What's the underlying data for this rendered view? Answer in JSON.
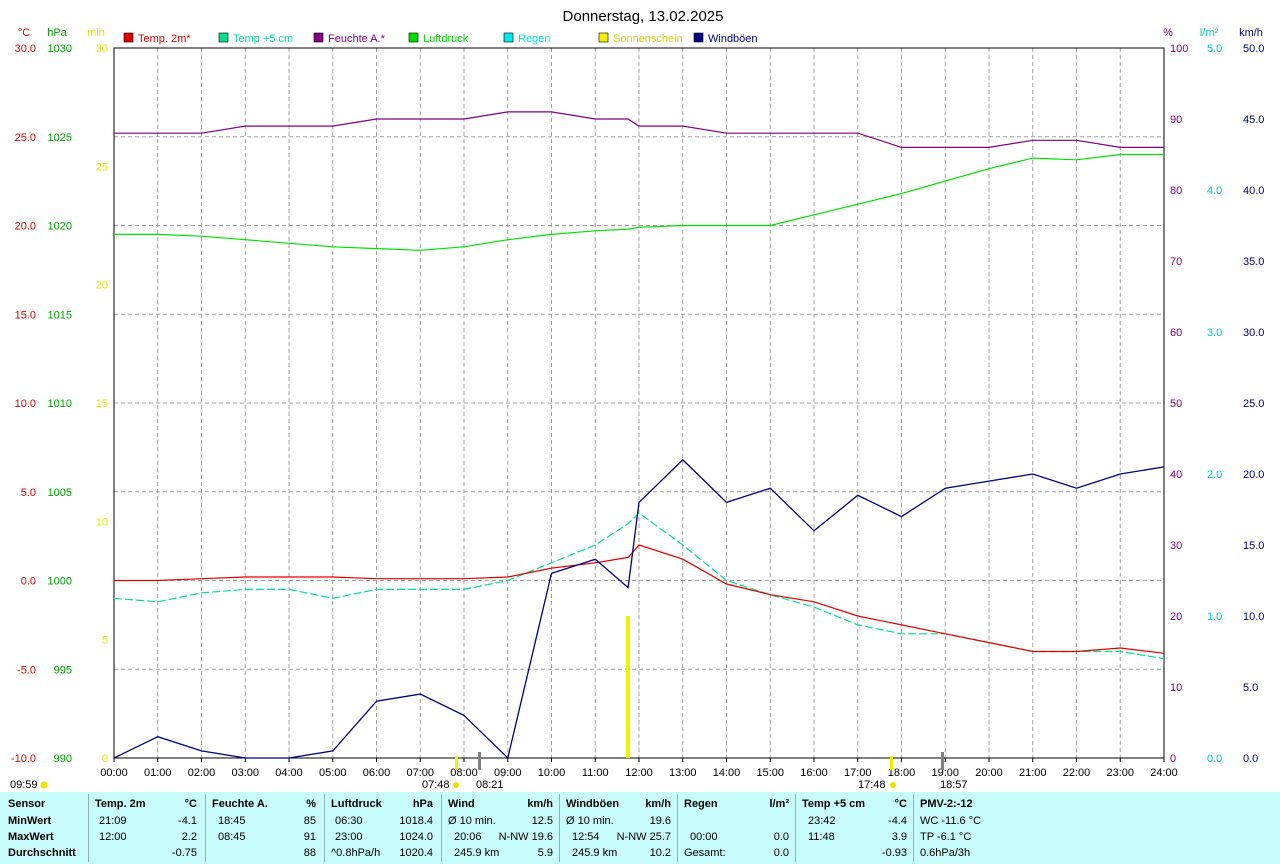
{
  "title": "Donnerstag, 13.02.2025",
  "legend": [
    {
      "label": "Temp. 2m*",
      "color": "#e00000"
    },
    {
      "label": "Temp +5 cm",
      "color": "#00e090"
    },
    {
      "label": "Feuchte A.*",
      "color": "#800080"
    },
    {
      "label": "Luftdruck",
      "color": "#00e000"
    },
    {
      "label": "Regen",
      "color": "#00e8e8"
    },
    {
      "label": "Sonnenschein",
      "color": "#f0f000"
    },
    {
      "label": "Windböen",
      "color": "#000080"
    }
  ],
  "axes": {
    "temp": {
      "unit": "°C",
      "ticks": [
        "30.0",
        "25.0",
        "20.0",
        "15.0",
        "10.0",
        "5.0",
        "0.0",
        "-5.0",
        "-10.0"
      ],
      "color": "#e00000"
    },
    "pressure": {
      "unit": "hPa",
      "ticks": [
        "1030",
        "1025",
        "1020",
        "1015",
        "1010",
        "1005",
        "1000",
        "995",
        "990"
      ],
      "color": "#00a000"
    },
    "sun": {
      "unit": "min",
      "ticks": [
        "30",
        "25",
        "20",
        "15",
        "10",
        "5",
        "0"
      ],
      "color": "#e8e800"
    },
    "humidity": {
      "unit": "%",
      "ticks": [
        "100",
        "90",
        "80",
        "70",
        "60",
        "50",
        "40",
        "30",
        "20",
        "10",
        "0"
      ],
      "color": "#800080"
    },
    "rain": {
      "unit": "l/m²",
      "ticks": [
        "5.0",
        "4.0",
        "3.0",
        "2.0",
        "1.0",
        "0.0"
      ],
      "color": "#00c8c8"
    },
    "wind": {
      "unit": "km/h",
      "ticks": [
        "50.0",
        "45.0",
        "40.0",
        "35.0",
        "30.0",
        "25.0",
        "20.0",
        "15.0",
        "10.0",
        "5.0",
        "0.0"
      ],
      "color": "#000080"
    },
    "time": [
      "00:00",
      "01:00",
      "02:00",
      "03:00",
      "04:00",
      "05:00",
      "06:00",
      "07:00",
      "08:00",
      "09:00",
      "10:00",
      "11:00",
      "12:00",
      "13:00",
      "14:00",
      "15:00",
      "16:00",
      "17:00",
      "18:00",
      "19:00",
      "20:00",
      "21:00",
      "22:00",
      "23:00",
      "24:00"
    ]
  },
  "markers": {
    "update": "09:59",
    "sunrise": "07:48",
    "moonset": "08:21",
    "sunset": "17:48",
    "moonrise": "18:57"
  },
  "chart_data": {
    "type": "line",
    "x": [
      "00:00",
      "01:00",
      "02:00",
      "03:00",
      "04:00",
      "05:00",
      "06:00",
      "07:00",
      "08:00",
      "09:00",
      "10:00",
      "11:00",
      "11:45",
      "12:00",
      "13:00",
      "14:00",
      "15:00",
      "16:00",
      "17:00",
      "18:00",
      "19:00",
      "20:00",
      "21:00",
      "22:00",
      "23:00",
      "24:00"
    ],
    "series": [
      {
        "name": "Temp. 2m*",
        "axis": "temp",
        "unit": "°C",
        "values": [
          0.0,
          0.0,
          0.1,
          0.2,
          0.2,
          0.2,
          0.1,
          0.1,
          0.1,
          0.2,
          0.7,
          1.0,
          1.3,
          2.0,
          1.2,
          -0.2,
          -0.8,
          -1.2,
          -2.0,
          -2.5,
          -3.0,
          -3.5,
          -4.0,
          -4.0,
          -3.8,
          -4.1
        ]
      },
      {
        "name": "Temp +5 cm",
        "axis": "temp",
        "unit": "°C",
        "values": [
          -1.0,
          -1.2,
          -0.7,
          -0.5,
          -0.5,
          -1.0,
          -0.5,
          -0.5,
          -0.5,
          0.0,
          1.0,
          2.0,
          3.2,
          3.8,
          2.0,
          0.0,
          -0.8,
          -1.5,
          -2.5,
          -3.0,
          -3.0,
          -3.5,
          -4.0,
          -4.0,
          -4.0,
          -4.4
        ]
      },
      {
        "name": "Feuchte A.*",
        "axis": "humidity",
        "unit": "%",
        "values": [
          88,
          88,
          88,
          89,
          89,
          89,
          90,
          90,
          90,
          91,
          91,
          90,
          90,
          89,
          89,
          88,
          88,
          88,
          88,
          86,
          86,
          86,
          87,
          87,
          86,
          86
        ]
      },
      {
        "name": "Luftdruck",
        "axis": "pressure",
        "unit": "hPa",
        "values": [
          1019.5,
          1019.5,
          1019.4,
          1019.2,
          1019.0,
          1018.8,
          1018.7,
          1018.6,
          1018.8,
          1019.2,
          1019.5,
          1019.7,
          1019.8,
          1019.9,
          1020.0,
          1020.0,
          1020.0,
          1020.6,
          1021.2,
          1021.8,
          1022.5,
          1023.2,
          1023.8,
          1023.7,
          1024.0,
          1024.0
        ]
      },
      {
        "name": "Windböen",
        "axis": "wind",
        "unit": "km/h",
        "values": [
          0.0,
          1.5,
          0.5,
          0.0,
          0.0,
          0.5,
          4.0,
          4.5,
          3.0,
          0.0,
          13.0,
          14.0,
          12.0,
          18.0,
          21.0,
          18.0,
          19.0,
          16.0,
          18.5,
          17.0,
          19.0,
          19.5,
          20.0,
          19.0,
          20.0,
          20.5
        ]
      }
    ],
    "sunshine": {
      "name": "Sonnenschein",
      "axis": "sun",
      "unit": "min",
      "bars": [
        {
          "x": "11:45",
          "value": 6
        }
      ]
    },
    "xlabel": "",
    "ylim_temp": [
      -10,
      30
    ],
    "ylim_pressure": [
      990,
      1030
    ],
    "ylim_humidity": [
      0,
      100
    ],
    "ylim_rain": [
      0,
      5
    ],
    "ylim_wind": [
      0,
      50
    ],
    "ylim_sun": [
      0,
      30
    ],
    "grid": true
  },
  "stats": {
    "headers": [
      {
        "name": "Sensor",
        "unit": ""
      },
      {
        "name": "Temp. 2m",
        "unit": "°C"
      },
      {
        "name": "Feuchte A.",
        "unit": "%"
      },
      {
        "name": "Luftdruck",
        "unit": "hPa"
      },
      {
        "name": "Wind",
        "unit": "km/h"
      },
      {
        "name": "Windböen",
        "unit": "km/h"
      },
      {
        "name": "Regen",
        "unit": "l/m²"
      },
      {
        "name": "Temp +5 cm",
        "unit": "°C"
      },
      {
        "name": "PMV-2:-12",
        "unit": ""
      }
    ],
    "rows": [
      "MinWert",
      "MaxWert",
      "Durchschnitt"
    ],
    "temp2m": {
      "min_time": "21:09",
      "min": "-4.1",
      "max_time": "12:00",
      "max": "2.2",
      "avg": "-0.75"
    },
    "humidity": {
      "min_time": "18:45",
      "min": "85",
      "max_time": "08:45",
      "max": "91",
      "avg": "88"
    },
    "pressure": {
      "min_time": "06:30",
      "min": "1018.4",
      "max_time": "23:00",
      "max": "1024.0",
      "trend": "^0.8hPa/h",
      "avg": "1020.4"
    },
    "wind": {
      "r1_label": "Ø 10 min.",
      "r1_val": "12.5",
      "r2_time": "20:06",
      "r2_dir": "N-NW 19.6",
      "r3_label": "245.9 km",
      "r3_val": "5.9"
    },
    "gust": {
      "r1_label": "Ø 10 min.",
      "r1_val": "19.6",
      "r2_time": "12:54",
      "r2_dir": "N-NW 25.7",
      "r3_label": "245.9 km",
      "r3_val": "10.2"
    },
    "rain": {
      "r2_time": "00:00",
      "r2_val": "0.0",
      "r3_label": "Gesamt:",
      "r3_val": "0.0"
    },
    "temp5cm": {
      "min_time": "23:42",
      "min": "-4.4",
      "max_time": "11:48",
      "max": "3.9",
      "avg": "-0.93"
    },
    "pmv": {
      "r1": "WC -11.6 °C",
      "r2": "TP -6.1 °C",
      "r3": "0.6hPa/3h"
    }
  }
}
